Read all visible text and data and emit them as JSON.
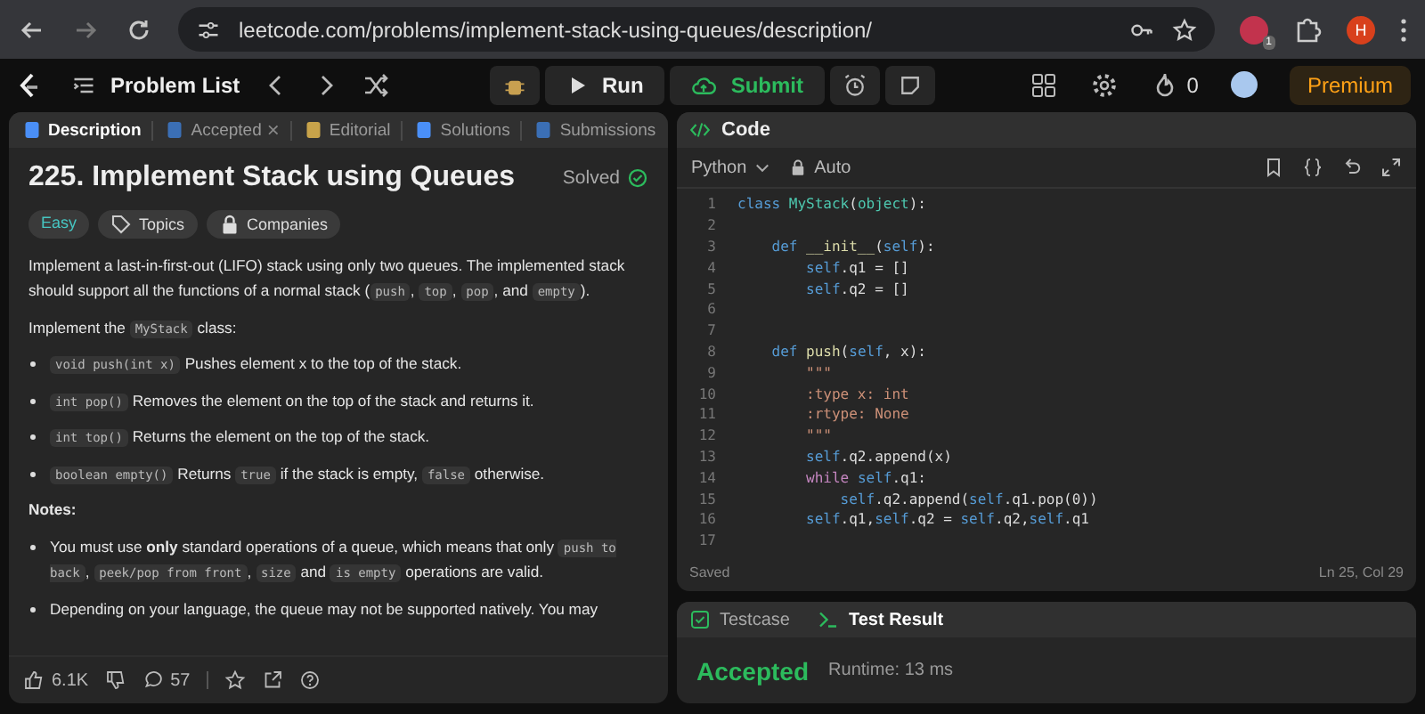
{
  "browser": {
    "url": "leetcode.com/problems/implement-stack-using-queues/description/",
    "extension_badge": "1",
    "profile_initial": "H"
  },
  "toolbar": {
    "problem_list": "Problem List",
    "run": "Run",
    "submit": "Submit",
    "streak": "0",
    "premium": "Premium"
  },
  "left_tabs": [
    {
      "label": "Description",
      "selected": true,
      "kind": "description"
    },
    {
      "label": "Accepted",
      "selected": false,
      "kind": "accepted",
      "close": "×"
    },
    {
      "label": "Editorial",
      "selected": false,
      "kind": "editorial"
    },
    {
      "label": "Solutions",
      "selected": false,
      "kind": "solutions"
    },
    {
      "label": "Submissions",
      "selected": false,
      "kind": "submissions"
    }
  ],
  "problem": {
    "title": "225. Implement Stack using Queues",
    "status": "Solved",
    "tags": [
      {
        "label": "Easy",
        "kind": "difficulty"
      },
      {
        "label": "Topics",
        "kind": "topics"
      },
      {
        "label": "Companies",
        "kind": "companies"
      }
    ],
    "blocks": [
      {
        "kind": "para",
        "parts": [
          {
            "kind": "text",
            "text": "Implement a last-in-first-out (LIFO) stack using only two queues. The implemented stack should support all the functions of a normal stack ("
          },
          {
            "kind": "code",
            "text": "push"
          },
          {
            "kind": "text",
            "text": ", "
          },
          {
            "kind": "code",
            "text": "top"
          },
          {
            "kind": "text",
            "text": ", "
          },
          {
            "kind": "code",
            "text": "pop"
          },
          {
            "kind": "text",
            "text": ", and "
          },
          {
            "kind": "code",
            "text": "empty"
          },
          {
            "kind": "text",
            "text": ")."
          }
        ]
      },
      {
        "kind": "para",
        "parts": [
          {
            "kind": "text",
            "text": "Implement the "
          },
          {
            "kind": "code",
            "text": "MyStack"
          },
          {
            "kind": "text",
            "text": " class:"
          }
        ]
      },
      {
        "kind": "bullet",
        "parts": [
          {
            "kind": "code",
            "text": "void push(int x)"
          },
          {
            "kind": "text",
            "text": " Pushes element x to the top of the stack."
          }
        ]
      },
      {
        "kind": "bullet",
        "parts": [
          {
            "kind": "code",
            "text": "int pop()"
          },
          {
            "kind": "text",
            "text": " Removes the element on the top of the stack and returns it."
          }
        ]
      },
      {
        "kind": "bullet",
        "parts": [
          {
            "kind": "code",
            "text": "int top()"
          },
          {
            "kind": "text",
            "text": " Returns the element on the top of the stack."
          }
        ]
      },
      {
        "kind": "bullet",
        "parts": [
          {
            "kind": "code",
            "text": "boolean empty()"
          },
          {
            "kind": "text",
            "text": " Returns "
          },
          {
            "kind": "code",
            "text": "true"
          },
          {
            "kind": "text",
            "text": " if the stack is empty, "
          },
          {
            "kind": "code",
            "text": "false"
          },
          {
            "kind": "text",
            "text": " otherwise."
          }
        ]
      },
      {
        "kind": "heading",
        "text": "Notes:"
      },
      {
        "kind": "bullet",
        "parts": [
          {
            "kind": "text",
            "text": "You must use "
          },
          {
            "kind": "bold",
            "text": "only"
          },
          {
            "kind": "text",
            "text": " standard operations of a queue, which means that only "
          },
          {
            "kind": "code",
            "text": "push to back"
          },
          {
            "kind": "text",
            "text": ", "
          },
          {
            "kind": "code",
            "text": "peek/pop from front"
          },
          {
            "kind": "text",
            "text": ", "
          },
          {
            "kind": "code",
            "text": "size"
          },
          {
            "kind": "text",
            "text": " and "
          },
          {
            "kind": "code",
            "text": "is empty"
          },
          {
            "kind": "text",
            "text": " operations are valid."
          }
        ]
      },
      {
        "kind": "bullet",
        "parts": [
          {
            "kind": "text",
            "text": "Depending on your language, the queue may not be supported natively. You may"
          }
        ]
      }
    ]
  },
  "footer": {
    "likes": "6.1K",
    "comments": "57"
  },
  "code": {
    "title": "Code",
    "language": "Python",
    "mode": "Auto",
    "status": "Saved",
    "cursor": "Ln 25, Col 29",
    "lines": [
      {
        "number": "1",
        "tokens": [
          {
            "kind": "kw",
            "text": "class "
          },
          {
            "kind": "name",
            "text": "MyStack"
          },
          {
            "kind": "plain",
            "text": "("
          },
          {
            "kind": "name",
            "text": "object"
          },
          {
            "kind": "plain",
            "text": "):"
          }
        ]
      },
      {
        "number": "2"
      },
      {
        "number": "3",
        "tokens": [
          {
            "kind": "kw",
            "text": "    def "
          },
          {
            "kind": "fn",
            "text": "__init__"
          },
          {
            "kind": "plain",
            "text": "("
          },
          {
            "kind": "self",
            "text": "self"
          },
          {
            "kind": "plain",
            "text": "):"
          }
        ]
      },
      {
        "number": "4",
        "tokens": [
          {
            "kind": "self",
            "text": "        self"
          },
          {
            "kind": "plain",
            "text": ".q1 = []"
          }
        ]
      },
      {
        "number": "5",
        "tokens": [
          {
            "kind": "self",
            "text": "        self"
          },
          {
            "kind": "plain",
            "text": ".q2 = []"
          }
        ]
      },
      {
        "number": "6"
      },
      {
        "number": "7"
      },
      {
        "number": "8",
        "tokens": [
          {
            "kind": "kw",
            "text": "    def "
          },
          {
            "kind": "fn",
            "text": "push"
          },
          {
            "kind": "plain",
            "text": "("
          },
          {
            "kind": "self",
            "text": "self"
          },
          {
            "kind": "plain",
            "text": ", x):"
          }
        ]
      },
      {
        "number": "9",
        "tokens": [
          {
            "kind": "doc",
            "text": "        \"\"\""
          }
        ]
      },
      {
        "number": "10",
        "tokens": [
          {
            "kind": "doc",
            "text": "        :type x: int"
          }
        ]
      },
      {
        "number": "11",
        "tokens": [
          {
            "kind": "doc",
            "text": "        :rtype: None"
          }
        ]
      },
      {
        "number": "12",
        "tokens": [
          {
            "kind": "doc",
            "text": "        \"\"\""
          }
        ]
      },
      {
        "number": "13",
        "tokens": [
          {
            "kind": "self",
            "text": "        self"
          },
          {
            "kind": "plain",
            "text": ".q2.append(x)"
          }
        ]
      },
      {
        "number": "14",
        "tokens": [
          {
            "kind": "ctl",
            "text": "        while "
          },
          {
            "kind": "self",
            "text": "self"
          },
          {
            "kind": "plain",
            "text": ".q1:"
          }
        ]
      },
      {
        "number": "15",
        "tokens": [
          {
            "kind": "self",
            "text": "            self"
          },
          {
            "kind": "plain",
            "text": ".q2.append("
          },
          {
            "kind": "self",
            "text": "self"
          },
          {
            "kind": "plain",
            "text": ".q1.pop(0))"
          }
        ]
      },
      {
        "number": "16",
        "tokens": [
          {
            "kind": "self",
            "text": "        self"
          },
          {
            "kind": "plain",
            "text": ".q1,"
          },
          {
            "kind": "self",
            "text": "self"
          },
          {
            "kind": "plain",
            "text": ".q2 = "
          },
          {
            "kind": "self",
            "text": "self"
          },
          {
            "kind": "plain",
            "text": ".q2,"
          },
          {
            "kind": "self",
            "text": "self"
          },
          {
            "kind": "plain",
            "text": ".q1"
          }
        ]
      },
      {
        "number": "17"
      }
    ]
  },
  "result_tabs": [
    {
      "label": "Testcase",
      "selected": false,
      "kind": "testcase"
    },
    {
      "label": "Test Result",
      "selected": true,
      "kind": "result"
    }
  ],
  "result": {
    "verdict": "Accepted",
    "runtime": "Runtime: 13 ms"
  }
}
